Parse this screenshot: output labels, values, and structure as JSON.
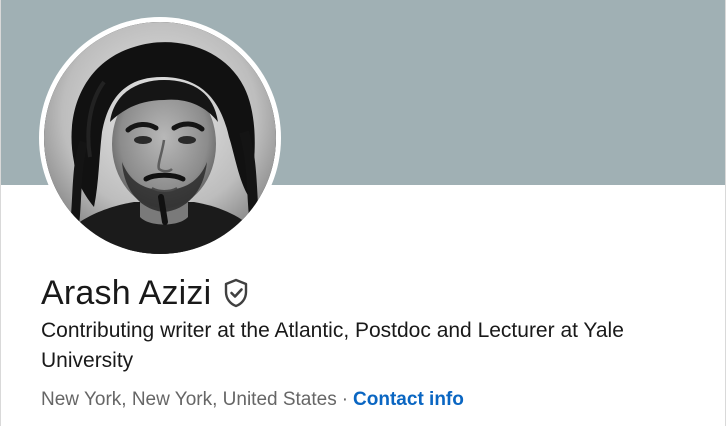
{
  "profile": {
    "name": "Arash Azizi",
    "verified_icon": "shield-check-icon",
    "headline": "Contributing writer at the Atlantic, Postdoc and Lecturer at Yale University",
    "location": "New York, New York, United States",
    "separator": "·",
    "contact_link": "Contact info"
  },
  "colors": {
    "cover": "#a0b0b4",
    "link": "#0a66c2",
    "text": "#191919",
    "muted": "#666666"
  }
}
